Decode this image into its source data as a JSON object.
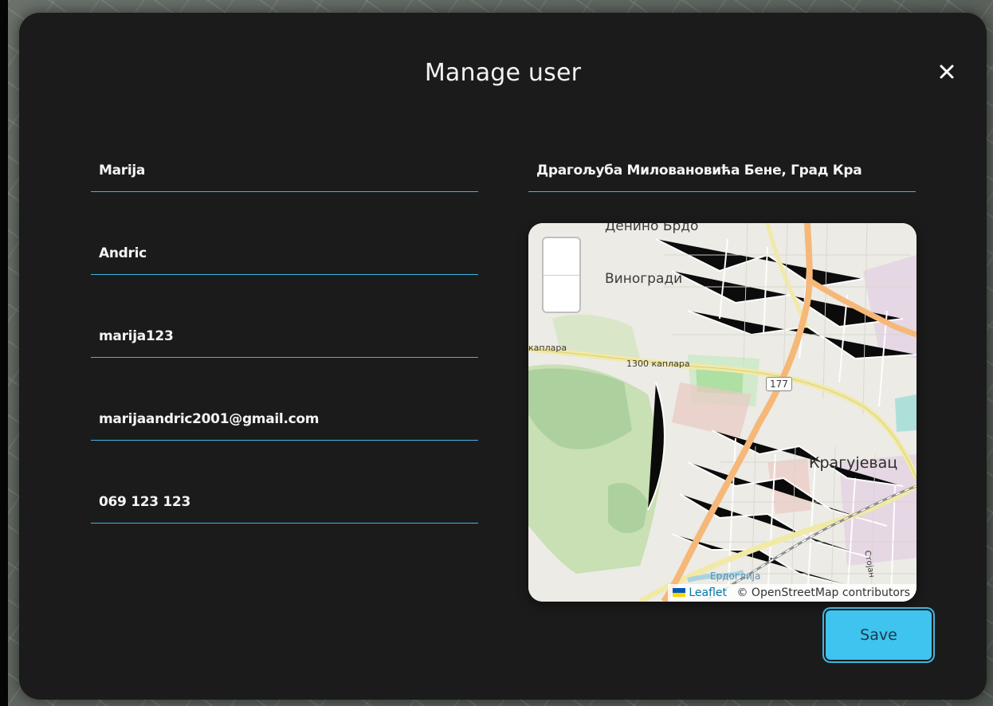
{
  "modal": {
    "title": "Manage user",
    "close_icon": "close-icon",
    "save_label": "Save"
  },
  "form": {
    "first_name": "Marija",
    "last_name": "Andric",
    "username": "marija123",
    "email": "marijaandric2001@gmail.com",
    "phone": "069 123 123",
    "address": "Драгољуба Миловановића Бене, Град Кра"
  },
  "map": {
    "places": {
      "top": "Денино Брдо",
      "vinogradi": "Виногради",
      "city": "Крагујевац",
      "road_label_left": "каплара",
      "road_label": "1300 каплара",
      "route_shield": "177",
      "storage": "Стојан",
      "bottom": "Ердоглија"
    },
    "attribution": {
      "leaflet": "Leaflet",
      "osm": "© OpenStreetMap contributors"
    },
    "zoom_in_icon": "zoom-in-icon",
    "zoom_out_icon": "zoom-out-icon"
  },
  "colors": {
    "accent": "#3fb6df",
    "save_bg": "#3fc3ef",
    "modal_bg": "#1b1b1c"
  }
}
